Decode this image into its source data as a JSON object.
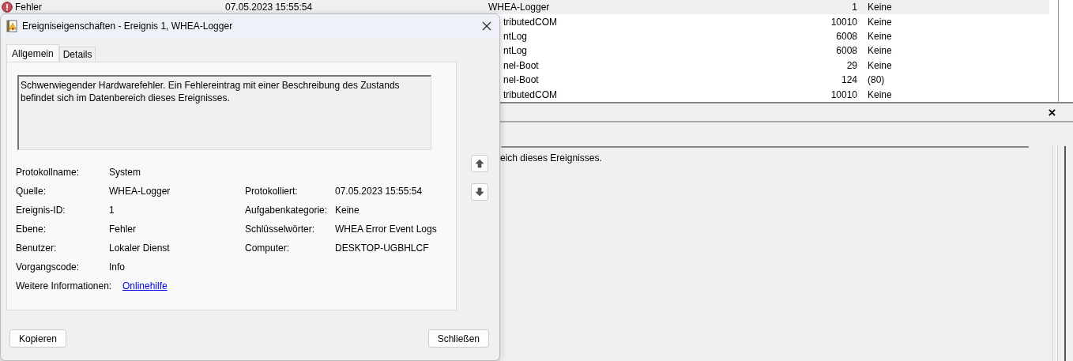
{
  "event_list": {
    "rows": [
      {
        "level": "Fehler",
        "kind": "error",
        "date": "07.05.2023 15:55:54",
        "source": "WHEA-Logger",
        "event_id": "1",
        "task_category": "Keine",
        "selected": true
      },
      {
        "source": "tributedCOM",
        "event_id": "10010",
        "task_category": "Keine",
        "selected": false
      },
      {
        "source": "ntLog",
        "event_id": "6008",
        "task_category": "Keine",
        "selected": false
      },
      {
        "source": "ntLog",
        "event_id": "6008",
        "task_category": "Keine",
        "selected": false
      },
      {
        "source": "nel-Boot",
        "event_id": "29",
        "task_category": "Keine",
        "selected": false
      },
      {
        "source": "nel-Boot",
        "event_id": "124",
        "task_category": "(80)",
        "selected": false
      },
      {
        "source": "tributedCOM",
        "event_id": "10010",
        "task_category": "Keine",
        "selected": false
      }
    ]
  },
  "preview_pane": {
    "description_fragment": "eich dieses Ereignisses."
  },
  "dialog": {
    "title": "Ereigniseigenschaften - Ereignis 1, WHEA-Logger",
    "tabs": [
      {
        "label": "Allgemein",
        "selected": true
      },
      {
        "label": "Details",
        "selected": false
      }
    ],
    "description": "Schwerwiegender Hardwarefehler. Ein Fehlereintrag mit einer Beschreibung des Zustands befindet sich im Datenbereich dieses Ereignisses.",
    "field_rows": [
      {
        "left": {
          "label": "Protokollname:",
          "value": "System"
        }
      },
      {
        "left": {
          "label": "Quelle:",
          "value": "WHEA-Logger"
        },
        "right": {
          "label": "Protokolliert:",
          "value": "07.05.2023 15:55:54"
        }
      },
      {
        "left": {
          "label": "Ereignis-ID:",
          "value": "1"
        },
        "right": {
          "label": "Aufgabenkategorie:",
          "value": "Keine"
        }
      },
      {
        "left": {
          "label": "Ebene:",
          "value": "Fehler"
        },
        "right": {
          "label": "Schlüsselwörter:",
          "value": "WHEA Error Event Logs"
        }
      },
      {
        "left": {
          "label": "Benutzer:",
          "value": "Lokaler Dienst"
        },
        "right": {
          "label": "Computer:",
          "value": "DESKTOP-UGBHLCF"
        }
      },
      {
        "left": {
          "label": "Vorgangscode:",
          "value": "Info"
        }
      },
      {
        "left": {
          "label": "Weitere Informationen:",
          "value": "Onlinehilfe",
          "kind": "link"
        }
      }
    ],
    "buttons": [
      "Kopieren",
      "Schließen"
    ]
  }
}
